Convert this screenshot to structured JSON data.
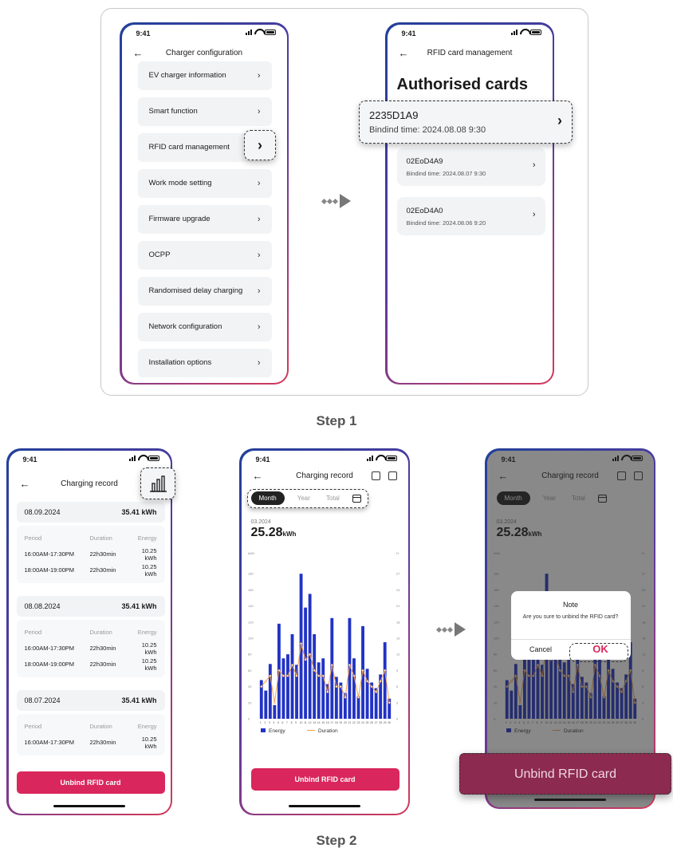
{
  "status_time": "9:41",
  "step1_label": "Step 1",
  "step2_label": "Step 2",
  "phone1": {
    "title": "Charger configuration",
    "items": [
      "EV charger information",
      "Smart function",
      "RFID card management",
      "Work mode setting",
      "Firmware upgrade",
      "OCPP",
      "Randomised delay charging",
      "Network configuration",
      "Installation options"
    ]
  },
  "phone2": {
    "title": "RFID card management",
    "heading": "Authorised cards",
    "highlight_card": {
      "id": "2235D1A9",
      "time": "Bindind time: 2024.08.08 9:30"
    },
    "cards": [
      {
        "id": "02EoD4A9",
        "time": "Bindind time: 2024.08.07 9:30"
      },
      {
        "id": "02EoD4A0",
        "time": "Bindind time: 2024.08.06 9:20"
      }
    ]
  },
  "phone3": {
    "title": "Charging record",
    "col_period": "Period",
    "col_duration": "Duration",
    "col_energy": "Energy",
    "records": [
      {
        "date": "08.09.2024",
        "total": "35.41 kWh",
        "rows": [
          [
            "16:00AM-17:30PM",
            "22h30min",
            "10.25 kWh"
          ],
          [
            "18:00AM-19:00PM",
            "22h30min",
            "10.25 kWh"
          ]
        ]
      },
      {
        "date": "08.08.2024",
        "total": "35.41 kWh",
        "rows": [
          [
            "16:00AM-17:30PM",
            "22h30min",
            "10.25 kWh"
          ],
          [
            "18:00AM-19:00PM",
            "22h30min",
            "10.25 kWh"
          ]
        ]
      },
      {
        "date": "08.07.2024",
        "total": "35.41 kWh",
        "rows": [
          [
            "16:00AM-17:30PM",
            "22h30min",
            "10.25 kWh"
          ]
        ]
      }
    ],
    "unbind_label": "Unbind RFID card"
  },
  "phone4": {
    "title": "Charging record",
    "tabs": [
      "Month",
      "Year",
      "Total"
    ],
    "date": "03.2024",
    "total_value": "25.28",
    "total_unit": "kWh",
    "unbind_label": "Unbind RFID card"
  },
  "phone5": {
    "dialog_title": "Note",
    "dialog_message": "Are you sure to unbind the RFID card?",
    "cancel_label": "Cancel",
    "ok_label": "OK",
    "big_unbind_label": "Unbind RFID card"
  },
  "colors": {
    "accent": "#d9275d",
    "bar": "#2233c4",
    "line": "#f0a050",
    "frame_gradient_start": "#22409a",
    "frame_gradient_end": "#d33a5a"
  },
  "chart_data": {
    "type": "bar",
    "categories": [
      "1",
      "2",
      "3",
      "4",
      "5",
      "6",
      "7",
      "8",
      "9",
      "10",
      "11",
      "12",
      "13",
      "14",
      "15",
      "16",
      "17",
      "18",
      "19",
      "20",
      "21",
      "22",
      "23",
      "24",
      "25",
      "26",
      "27",
      "28",
      "29",
      "30"
    ],
    "series": [
      {
        "name": "Energy",
        "values": [
          48,
          35,
          68,
          17,
          118,
          75,
          80,
          105,
          67,
          180,
          138,
          155,
          105,
          70,
          75,
          43,
          125,
          52,
          45,
          32,
          125,
          75,
          28,
          115,
          62,
          45,
          38,
          55,
          95,
          25
        ]
      },
      {
        "name": "Duration",
        "values": [
          6,
          7,
          8,
          3,
          9,
          8,
          8,
          10,
          8,
          14,
          11,
          12,
          9,
          8,
          8,
          5,
          10,
          6,
          6,
          4,
          10,
          8,
          4,
          9,
          7,
          6,
          5,
          7,
          9,
          3
        ]
      }
    ],
    "left_axis_label": "kWh",
    "right_axis_label": "H",
    "left_ticks": [
      0,
      20,
      40,
      60,
      80,
      100,
      120,
      140,
      160,
      180
    ],
    "right_ticks": [
      0,
      3,
      6,
      9,
      12,
      15,
      18,
      21,
      24,
      27
    ],
    "ylim": [
      0,
      200
    ],
    "legend": [
      "Energy",
      "Duration"
    ],
    "legend_position": "bottom-left"
  }
}
